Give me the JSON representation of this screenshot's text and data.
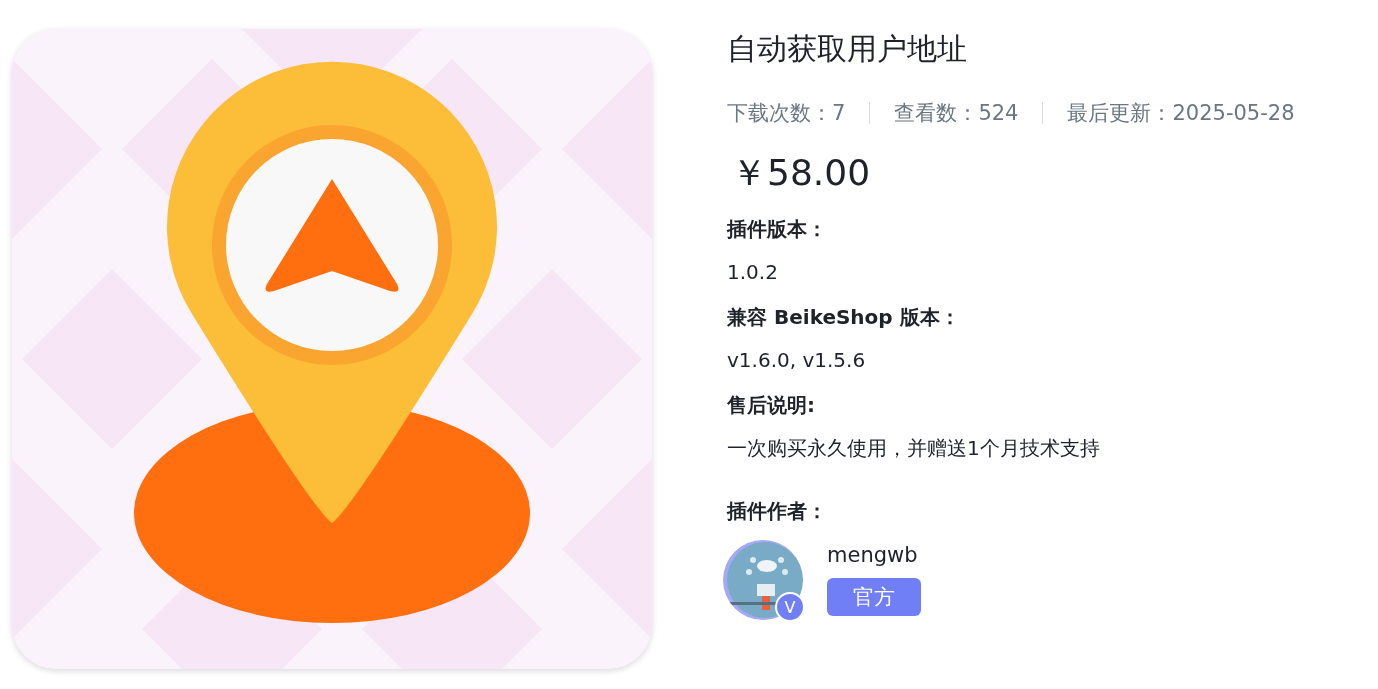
{
  "product": {
    "title": "自动获取用户地址",
    "stats": [
      "下载次数：7",
      "查看数：524",
      "最后更新：2025-05-28"
    ],
    "price": "￥58.00",
    "specs": [
      {
        "label": "插件版本：",
        "value": "1.0.2"
      },
      {
        "label": "兼容 BeikeShop 版本：",
        "value": "v1.6.0, v1.5.6"
      },
      {
        "label": "售后说明:",
        "value": "一次购买永久使用，并赠送1个月技术支持"
      }
    ],
    "author": {
      "label": "插件作者：",
      "name": "mengwb",
      "verified_mark": "V",
      "tag": "官方"
    }
  }
}
